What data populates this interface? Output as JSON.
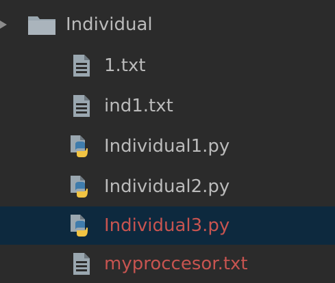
{
  "tree": {
    "folder": {
      "name": "Individual",
      "expanded": true,
      "icon": "folder-icon"
    },
    "files": [
      {
        "name": "1.txt",
        "icon": "text-file-icon",
        "status": "normal"
      },
      {
        "name": "ind1.txt",
        "icon": "text-file-icon",
        "status": "normal"
      },
      {
        "name": "Individual1.py",
        "icon": "python-file-icon",
        "status": "normal"
      },
      {
        "name": "Individual2.py",
        "icon": "python-file-icon",
        "status": "normal"
      },
      {
        "name": "Individual3.py",
        "icon": "python-file-icon",
        "status": "modified",
        "selected": true
      },
      {
        "name": "myproccesor.txt",
        "icon": "text-file-icon",
        "status": "modified"
      }
    ]
  },
  "colors": {
    "background": "#2b2b2b",
    "selection": "#0d293e",
    "text": "#bbbbbb",
    "modified_text": "#c75450",
    "folder": "#9aa7b0",
    "python_blue": "#3f7cac",
    "python_yellow": "#f2c443"
  }
}
